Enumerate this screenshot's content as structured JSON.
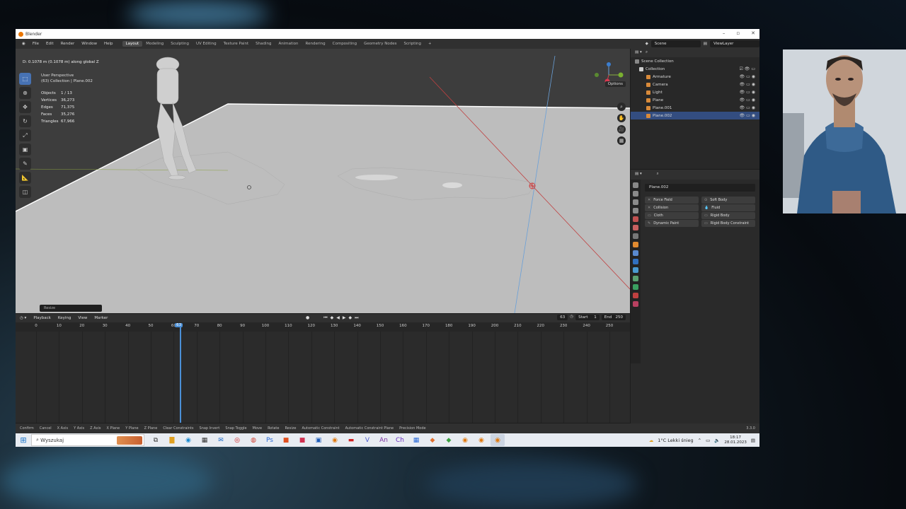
{
  "window": {
    "title": "Blender"
  },
  "menu": {
    "items": [
      "File",
      "Edit",
      "Render",
      "Window",
      "Help"
    ],
    "workspaces": [
      "Layout",
      "Modeling",
      "Sculpting",
      "UV Editing",
      "Texture Paint",
      "Shading",
      "Animation",
      "Rendering",
      "Compositing",
      "Geometry Nodes",
      "Scripting"
    ],
    "active_workspace": "Layout",
    "scene": "Scene",
    "view_layer": "ViewLayer"
  },
  "viewport": {
    "operator_status": "D: 0.1078 m (0.1078 m) along global Z",
    "view_name": "User Perspective",
    "collection_info": "(63) Collection | Plane.002",
    "stats": [
      {
        "k": "Objects",
        "v": "1 / 13"
      },
      {
        "k": "Vertices",
        "v": "36,273"
      },
      {
        "k": "Edges",
        "v": "71,375"
      },
      {
        "k": "Faces",
        "v": "35,276"
      },
      {
        "k": "Triangles",
        "v": "67,966"
      }
    ],
    "options_label": "Options",
    "last_op_panel": "Resize"
  },
  "outliner": {
    "root": "Scene Collection",
    "collection": "Collection",
    "items": [
      {
        "name": "Armature",
        "color": "#d88a3a"
      },
      {
        "name": "Camera",
        "color": "#d88a3a"
      },
      {
        "name": "Light",
        "color": "#d88a3a"
      },
      {
        "name": "Plane",
        "color": "#d88a3a"
      },
      {
        "name": "Plane.001",
        "color": "#d88a3a"
      },
      {
        "name": "Plane.002",
        "color": "#d88a3a",
        "selected": true
      }
    ]
  },
  "properties": {
    "object_name": "Plane.002",
    "physics_buttons": [
      {
        "left": "Force Field",
        "right": "Soft Body"
      },
      {
        "left": "Collision",
        "right": "Fluid"
      },
      {
        "left": "Cloth",
        "right": "Rigid Body"
      },
      {
        "left": "Dynamic Paint",
        "right": "Rigid Body Constraint"
      }
    ]
  },
  "timeline": {
    "menu": [
      "Playback",
      "Keying",
      "View",
      "Marker"
    ],
    "current_frame": "63",
    "start_label": "Start",
    "start": "1",
    "end_label": "End",
    "end": "250",
    "ticks": [
      "0",
      "10",
      "20",
      "30",
      "40",
      "50",
      "60",
      "70",
      "80",
      "90",
      "100",
      "110",
      "120",
      "130",
      "140",
      "150",
      "160",
      "170",
      "180",
      "190",
      "200",
      "210",
      "220",
      "230",
      "240",
      "250"
    ]
  },
  "statusbar": {
    "items": [
      "Confirm",
      "Cancel",
      "X Axis",
      "Y Axis",
      "Z Axis",
      "X Plane",
      "Y Plane",
      "Z Plane",
      "Clear Constraints",
      "Snap Invert",
      "Snap Toggle",
      "Move",
      "Rotate",
      "Resize",
      "Automatic Constraint",
      "Automatic Constraint Plane",
      "Precision Mode"
    ],
    "version": "3.3.0"
  },
  "taskbar": {
    "search_placeholder": "Wyszukaj",
    "weather": "1°C  Lekki śnieg",
    "time": "18:17",
    "date": "28.01.2023"
  }
}
